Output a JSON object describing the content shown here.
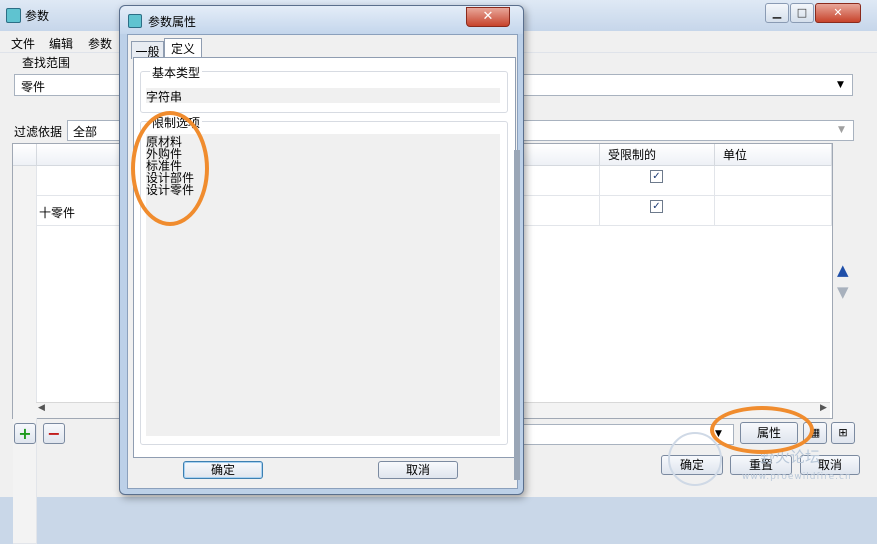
{
  "main": {
    "title": "参数",
    "caption_buttons": [
      "▁",
      "□",
      "✕"
    ],
    "menu": [
      "文件",
      "编辑",
      "参数"
    ],
    "search_scope_label": "查找范围",
    "search_scope_value": "零件",
    "filter_label": "过滤依据",
    "filter_value": "全部",
    "table": {
      "headers": [
        "受限制的",
        "单位"
      ],
      "rows": [
        {
          "name": "",
          "restricted": true
        },
        {
          "name": "十零件",
          "restricted": true
        }
      ]
    },
    "add_label": "+",
    "remove_label": "−",
    "properties_button": "属性",
    "ok_button": "确定",
    "reset_button": "重置",
    "cancel_button": "取消"
  },
  "dialog": {
    "title": "参数属性",
    "close_glyph": "✕",
    "tabs": [
      "一般",
      "定义"
    ],
    "base_type_label": "基本类型",
    "base_type_value": "字符串",
    "restriction_label": "限制选项",
    "restriction_items": [
      "原材料",
      "外购件",
      "标准件",
      "设计部件",
      "设计零件"
    ],
    "ok_button": "确定",
    "cancel_button": "取消"
  },
  "watermark": {
    "text": "野火论坛",
    "url": "www.proewildfire.cn"
  },
  "colors": {
    "annotation": "#f08c2e",
    "scroll_arrow": "#1f4fa8"
  }
}
